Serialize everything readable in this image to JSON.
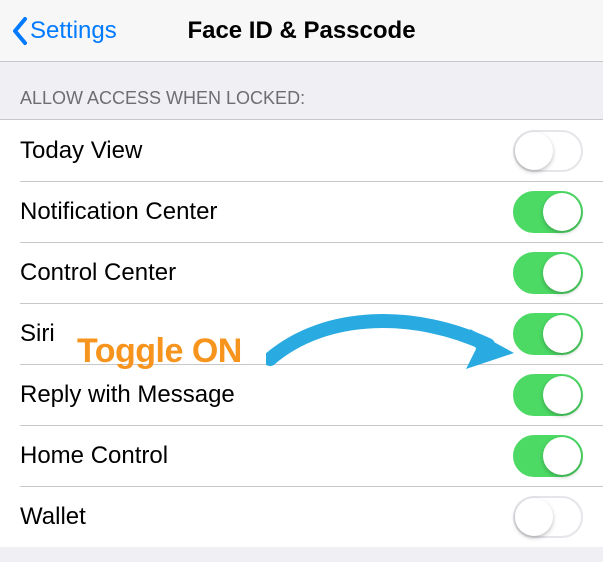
{
  "navbar": {
    "back_label": "Settings",
    "title": "Face ID & Passcode"
  },
  "section": {
    "header": "ALLOW ACCESS WHEN LOCKED:"
  },
  "rows": [
    {
      "label": "Today View",
      "on": false
    },
    {
      "label": "Notification Center",
      "on": true
    },
    {
      "label": "Control Center",
      "on": true
    },
    {
      "label": "Siri",
      "on": true
    },
    {
      "label": "Reply with Message",
      "on": true
    },
    {
      "label": "Home Control",
      "on": true
    },
    {
      "label": "Wallet",
      "on": false
    }
  ],
  "annotation": {
    "text": "Toggle ON",
    "color": "#f7941d",
    "arrow_color": "#29abe2"
  }
}
